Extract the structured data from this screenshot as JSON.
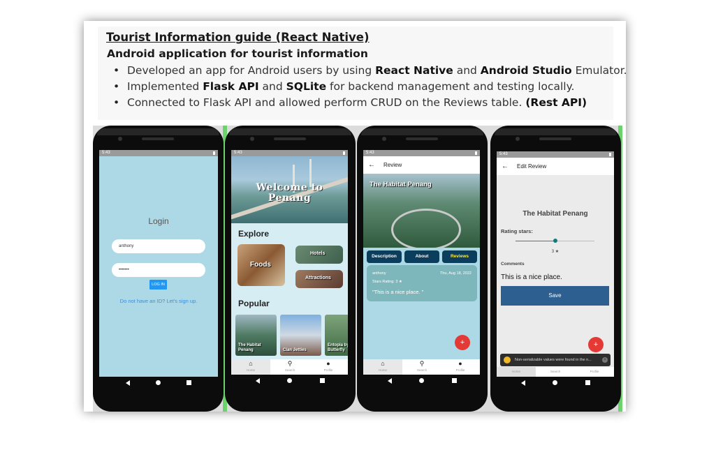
{
  "slide": {
    "title": "Tourist Information guide (React Native)",
    "subtitle": "Android application for tourist information",
    "bullets": [
      {
        "pre": "Developed an app for Android users by using ",
        "b1": "React Native",
        "mid": " and ",
        "b2": "Android Studio",
        "post": " Emulator."
      },
      {
        "pre": "Implemented ",
        "b1": "Flask API",
        "mid": " and ",
        "b2": "SQLite",
        "post": " for backend management and testing locally."
      },
      {
        "pre": "Connected to Flask API and allowed perform CRUD on the Reviews table. ",
        "b1": "(Rest API)"
      }
    ]
  },
  "status_time": "5:43",
  "phone1": {
    "login_title": "Login",
    "username_value": "anthony",
    "password_value": "•••••••",
    "login_button": "LOG IN",
    "signup_link": "Do not have an ID? Let's sign up."
  },
  "phone2": {
    "hero_text_line1": "Welcome to",
    "hero_text_line2": "Penang",
    "explore_title": "Explore",
    "explore_tiles": [
      "Foods",
      "Hotels",
      "Attractions"
    ],
    "popular_title": "Popular",
    "popular_cards": [
      "The Habitat Penang",
      "Clan Jetties",
      "Entopia by Penang Butterfly"
    ],
    "tabs": [
      "Home",
      "Search",
      "Profile"
    ]
  },
  "phone3": {
    "header_title": "Review",
    "place_name": "The Habitat Penang",
    "tabs": [
      "Description",
      "About",
      "Reviews"
    ],
    "review": {
      "user": "anthony",
      "date": "Thu, Aug 18, 2022",
      "rating": "Stars Rating: 3 ★",
      "comment": "\"This is a nice place. \""
    },
    "fab": "+",
    "tabs_bottom": [
      "Home",
      "Search",
      "Profile"
    ]
  },
  "phone4": {
    "header_title": "Edit Review",
    "place_name": "The Habitat Penang",
    "rating_label": "Rating stars:",
    "rating_value": "3 ★",
    "rating_fraction": 0.5,
    "comments_label": "Comments",
    "comment_value": "This is a nice place.",
    "save_button": "Save",
    "fab": "+",
    "toast": "Non-serializable values were found in the n...",
    "tabs_bottom": [
      "Home",
      "Search",
      "Profile"
    ]
  },
  "colors": {
    "login_bg": "#add8e6",
    "review_pill": "#0b3d5c",
    "reviews_active_text": "#ffeb3b",
    "save_button": "#2d5f91",
    "fab": "#e53935"
  },
  "icons": {
    "back": "arrow-left-icon",
    "home": "home-icon",
    "search": "search-icon",
    "profile": "person-icon",
    "nav_back": "triangle-back-icon",
    "nav_home": "circle-home-icon",
    "nav_recents": "square-recents-icon",
    "star": "star-icon"
  }
}
